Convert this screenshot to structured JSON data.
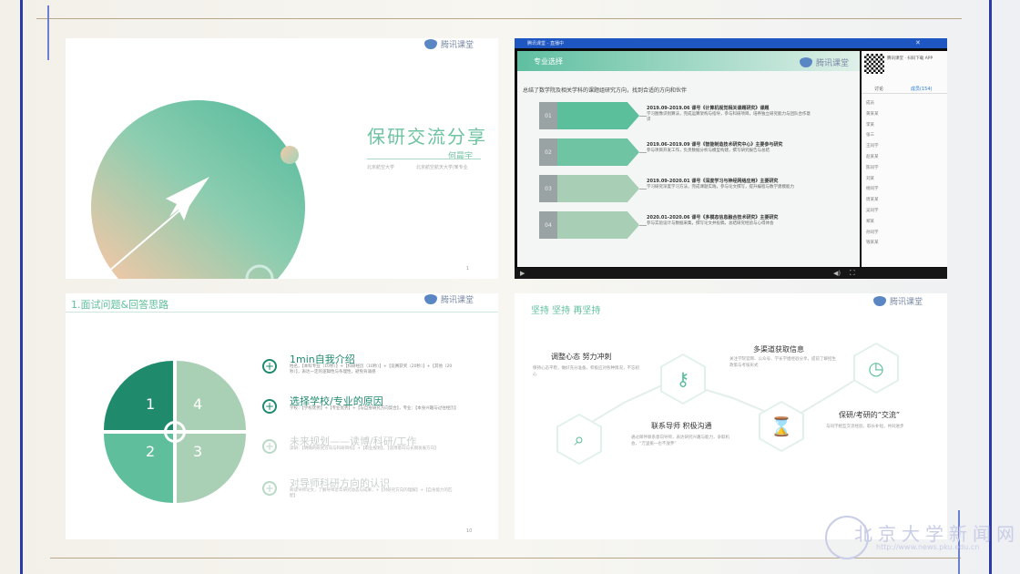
{
  "brand": {
    "logo_text": "腾讯课堂"
  },
  "panel1": {
    "title": "保研交流分享",
    "author": "何晨宇",
    "sub_left": "北京航空大学",
    "sub_right": "北京航空航天大学/某专业",
    "page": "1"
  },
  "panel2": {
    "window_title": "腾讯课堂 - 直播中",
    "slide_header": "专业选择",
    "question": "总结了数学院及相关学科的课题组研究方向，找到合适的方向和伙伴",
    "items": [
      {
        "num": "01",
        "title": "2019.09-2019.06 课号《计算机视觉相关课题研究》课题",
        "text": "学习图像识别算法，完成运算架构与指导，参与科研项目，培养独立研究能力与团队合作意识"
      },
      {
        "num": "02",
        "title": "2019.06-2019.09 课号《智能制造技术研究中心》主要参与研究",
        "text": "参与项目开发工作，负责数据分析与模型构建，撰写研究报告与总结"
      },
      {
        "num": "03",
        "title": "2019.09-2020.01 课号《深度学习与神经网络应用》主要研究",
        "text": "学习研究深度学习方法，完成课题实践，参与论文撰写，提升编程与数学建模能力"
      },
      {
        "num": "04",
        "title": "2020.01-2020.06 课号《多模态信息融合技术研究》主要研究",
        "text": "参与实验设计与数据采集，撰写论文并投稿，总结研究经验与心得体会"
      }
    ],
    "side_caption": "腾讯课堂 · 扫码下载 APP",
    "tabs": [
      "讨论",
      "成员(154)"
    ],
    "members": [
      "成员",
      "黄某某",
      "李某",
      "张三",
      "王同学",
      "赵某某",
      "陈同学",
      "刘某",
      "杨同学",
      "周某某",
      "吴同学",
      "郑某",
      "孙同学",
      "钱某某"
    ]
  },
  "panel3": {
    "header": "1.面试问题&回答思路",
    "quadrants": [
      "1",
      "4",
      "2",
      "3"
    ],
    "items": [
      {
        "title": "1min自我介绍",
        "text": "姓名，【本科专业（10秒）】+【科研经历（10秒）】+【竞赛获奖（20秒）】+【其他（20秒）】，表达一定的逻辑性与条理性，避免背诵感"
      },
      {
        "title": "选择学校/专业的原因",
        "text": "学校：【学校优势】+【专业优势】+【与自身研究方向契合】，专业：【本身兴趣与过往经历】"
      },
      {
        "title": "未来规划——读博/科研/工作",
        "text": "读研：【明确的研究方向与科研目标】+【职业规划】，【读博意向与长期发展方向】"
      },
      {
        "title": "对导师科研方向的认识",
        "text": "阅读导师论文，了解导师近年研究动态与成果，+【对研究方向的理解】+【自身能力的匹配】"
      }
    ],
    "page": "10"
  },
  "panel4": {
    "header": "坚持 坚持 再坚持",
    "blocks": [
      {
        "title": "调整心态 努力冲刺",
        "text": "保持心态平稳，做好充分准备，积极应对各种情况，不忘初心"
      },
      {
        "title": "多渠道获取信息",
        "text": "关注学院官网、公众号、学长学姐经验分享，提前了解招生政策与考核形式"
      },
      {
        "title": "保研/考研的“交流”",
        "text": "与同学相互交流经验，取长补短，共同进步"
      },
      {
        "title": "联系导师 积极沟通",
        "text": "通过邮件联系意向导师，表达研究兴趣与能力，争取机会，“万里挑一也不放弃”"
      }
    ],
    "icons": [
      "search-chart-icon",
      "key-icon",
      "hourglass-icon",
      "clock-icon"
    ]
  },
  "watermark": {
    "name": "北京大学新闻网",
    "url": "http://www.news.pku.edu.cn"
  }
}
